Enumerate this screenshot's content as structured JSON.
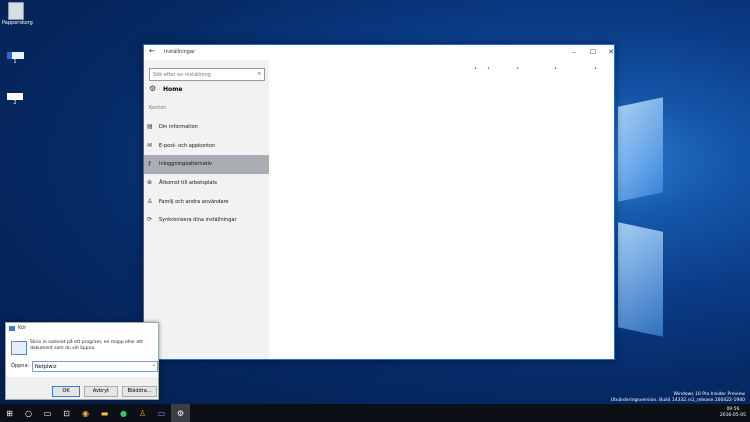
{
  "desktop": {
    "icons": [
      {
        "label": "Papperskorg"
      },
      {
        "label": "1"
      },
      {
        "label": "2"
      }
    ]
  },
  "settings": {
    "title": "Inställningar",
    "controls": {
      "back": "←",
      "minimize": "–",
      "maximize": "☐",
      "close": "✕"
    },
    "search_placeholder": "Sök efter en inställning",
    "home_label": "Home",
    "section_label": "Konton",
    "nav": [
      {
        "label": "Din information",
        "icon": "person-card-icon"
      },
      {
        "label": "E-post- och appkonton",
        "icon": "mail-icon"
      },
      {
        "label": "Inloggningsalternativ",
        "icon": "key-icon",
        "active": true
      },
      {
        "label": "Åtkomst till arbetsplats",
        "icon": "briefcase-icon"
      },
      {
        "label": "Familj och andra användare",
        "icon": "people-icon"
      },
      {
        "label": "Synkronisera dina inställningar",
        "icon": "sync-icon"
      }
    ]
  },
  "run_dialog": {
    "title": "Kör",
    "description": "Skriv in namnet på ett program, en mapp eller ett dokument som du vill öppna.",
    "open_label": "Öppna:",
    "open_value": "Netplwiz",
    "ok_label": "OK",
    "cancel_label": "Avbryt",
    "browse_label": "Bläddra..."
  },
  "watermark": {
    "line1": "Windows 10 Pro Insider Preview",
    "line2": "Utvärderingsversion. Build 14332.rs1_release.160422-1940"
  },
  "taskbar": {
    "time": "09:56",
    "date": "2016-05-05"
  }
}
